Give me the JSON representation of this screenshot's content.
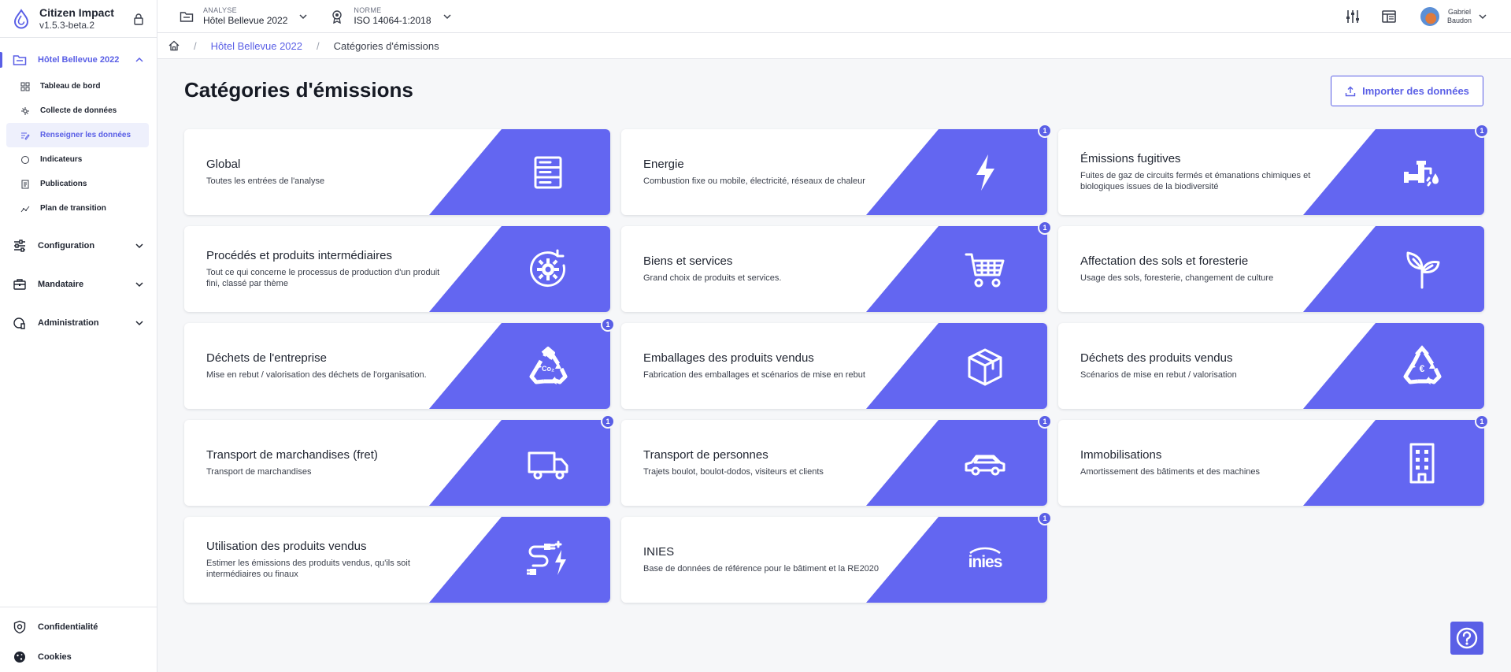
{
  "brand": {
    "name": "Citizen Impact",
    "version": "v1.5.3-beta.2"
  },
  "sidebar": {
    "active_project": "Hôtel Bellevue 2022",
    "sub_items": [
      {
        "label": "Tableau de bord"
      },
      {
        "label": "Collecte de données"
      },
      {
        "label": "Renseigner les données"
      },
      {
        "label": "Indicateurs"
      },
      {
        "label": "Publications"
      },
      {
        "label": "Plan de transition"
      }
    ],
    "groups": [
      {
        "label": "Configuration"
      },
      {
        "label": "Mandataire"
      },
      {
        "label": "Administration"
      }
    ],
    "bottom": [
      {
        "label": "Confidentialité"
      },
      {
        "label": "Cookies"
      }
    ]
  },
  "topbar": {
    "analysis_label": "ANALYSE",
    "analysis_value": "Hôtel Bellevue 2022",
    "norm_label": "NORME",
    "norm_value": "ISO 14064-1:2018",
    "user_first": "Gabriel",
    "user_last": "Baudon"
  },
  "breadcrumb": {
    "link": "Hôtel Bellevue 2022",
    "current": "Catégories d'émissions"
  },
  "page": {
    "title": "Catégories d'émissions",
    "import_label": "Importer des données"
  },
  "categories": [
    {
      "title": "Global",
      "desc": "Toutes les entrées de l'analyse",
      "icon": "server-icon",
      "badge": ""
    },
    {
      "title": "Energie",
      "desc": "Combustion fixe ou mobile, électricité, réseaux de chaleur",
      "icon": "lightning-icon",
      "badge": "1"
    },
    {
      "title": "Émissions fugitives",
      "desc": "Fuites de gaz de circuits fermés et émanations chimiques et biologiques issues de la biodiversité",
      "icon": "pipe-leak-icon",
      "badge": "1"
    },
    {
      "title": "Procédés et produits intermédiaires",
      "desc": "Tout ce qui concerne le processus de production d'un produit fini, classé par thème",
      "icon": "gear-cycle-icon",
      "badge": ""
    },
    {
      "title": "Biens et services",
      "desc": "Grand choix de produits et services.",
      "icon": "cart-icon",
      "badge": "1"
    },
    {
      "title": "Affectation des sols et foresterie",
      "desc": "Usage des sols, foresterie, changement de culture",
      "icon": "sprout-icon",
      "badge": ""
    },
    {
      "title": "Déchets de l'entreprise",
      "desc": "Mise en rebut / valorisation des déchets de l'organisation.",
      "icon": "recycle-co2-icon",
      "badge": "1"
    },
    {
      "title": "Emballages des produits vendus",
      "desc": "Fabrication des emballages et scénarios de mise en rebut",
      "icon": "box-icon",
      "badge": ""
    },
    {
      "title": "Déchets des produits vendus",
      "desc": "Scénarios de mise en rebut / valorisation",
      "icon": "recycle-euro-icon",
      "badge": ""
    },
    {
      "title": "Transport de marchandises (fret)",
      "desc": "Transport de marchandises",
      "icon": "truck-icon",
      "badge": "1"
    },
    {
      "title": "Transport de personnes",
      "desc": "Trajets boulot, boulot-dodos, visiteurs et clients",
      "icon": "car-icon",
      "badge": "1"
    },
    {
      "title": "Immobilisations",
      "desc": "Amortissement des bâtiments et des machines",
      "icon": "building-icon",
      "badge": "1"
    },
    {
      "title": "Utilisation des produits vendus",
      "desc": "Estimer les émissions des produits vendus, qu'ils soit intermédiaires ou finaux",
      "icon": "plug-power-icon",
      "badge": ""
    },
    {
      "title": "INIES",
      "desc": "Base de données de référence pour le bâtiment et la RE2020",
      "icon": "inies-logo",
      "logo_text": "inies",
      "badge": "1"
    }
  ],
  "colors": {
    "accent": "#5a5fe6",
    "band": "#6366f1"
  }
}
